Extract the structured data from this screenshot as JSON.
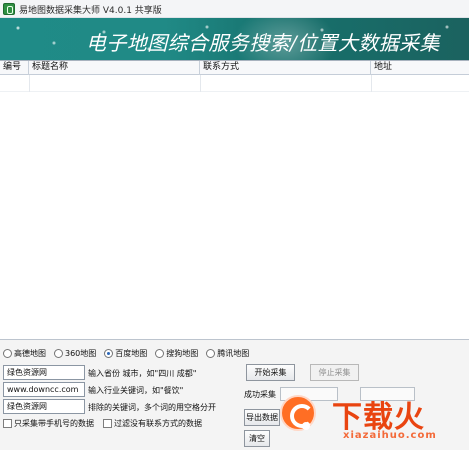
{
  "window": {
    "title": "易地图数据采集大师 V4.0.1 共享版",
    "app_icon": "app-icon"
  },
  "banner": {
    "text": "电子地图综合服务搜索/位置大数据采集"
  },
  "table": {
    "columns": [
      "编号",
      "标题名称",
      "联系方式",
      "地址"
    ],
    "rows": []
  },
  "map_sources": [
    {
      "label": "高德地图",
      "checked": false
    },
    {
      "label": "360地图",
      "checked": false
    },
    {
      "label": "百度地图",
      "checked": true
    },
    {
      "label": "搜狗地图",
      "checked": false
    },
    {
      "label": "腾讯地图",
      "checked": false
    }
  ],
  "form": {
    "city_value": "绿色资源网",
    "city_hint": "输入省份 城市，如\"四川 成都\"",
    "keyword_value": "www.downcc.com",
    "keyword_hint": "输入行业关键词，如\"餐饮\"",
    "exclude_value": "绿色资源网",
    "exclude_hint": "排除的关键词，多个词的用空格分开",
    "only_phone_label": "只采集带手机号的数据",
    "filter_no_contact_label": "过滤没有联系方式的数据"
  },
  "buttons": {
    "start": "开始采集",
    "stop": "停止采集",
    "export": "导出数据",
    "clear": "清空"
  },
  "status": {
    "success_label": "成功采集"
  },
  "watermark": {
    "brand": "下载火",
    "domain": "xiazaihuo.com"
  },
  "colors": {
    "banner": "#1f8b87",
    "selected_radio": "#2c67b7",
    "watermark": "#e94410"
  }
}
